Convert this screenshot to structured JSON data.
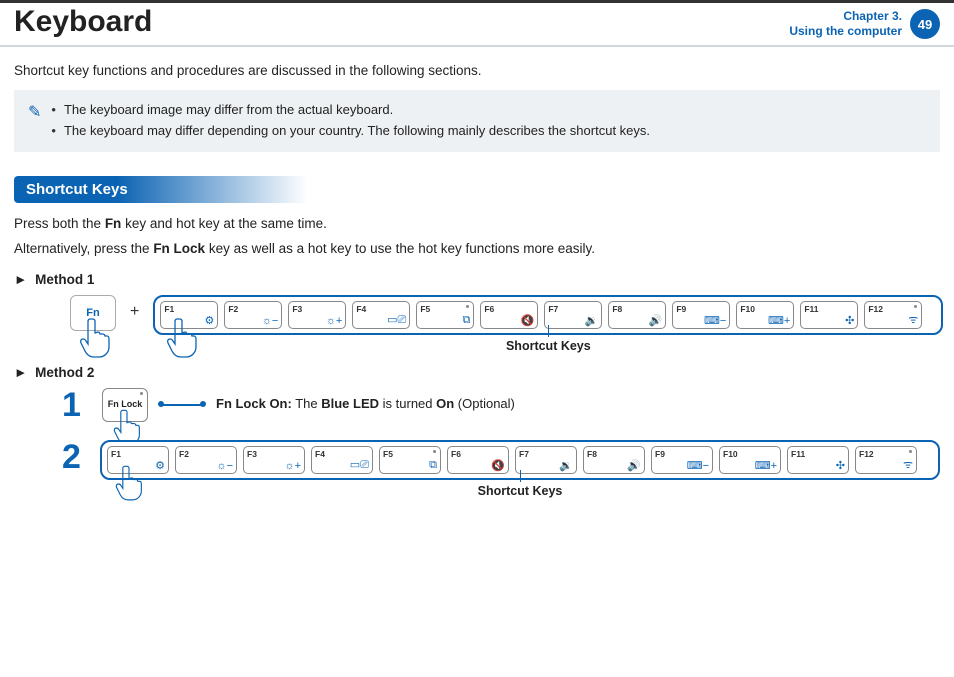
{
  "header": {
    "title": "Keyboard",
    "chapter_line1": "Chapter 3.",
    "chapter_line2": "Using the computer",
    "page_number": "49"
  },
  "intro": "Shortcut key functions and procedures are discussed in the following sections.",
  "notes": {
    "item1": "The keyboard image may differ from the actual keyboard.",
    "item2": "The keyboard may differ depending on your country. The following mainly describes the shortcut keys."
  },
  "section_heading": "Shortcut Keys",
  "body1_pre": "Press both the ",
  "body1_b": "Fn",
  "body1_post": " key and hot key at the same time.",
  "body2_pre": "Alternatively, press the ",
  "body2_b": "Fn Lock",
  "body2_post": " key as well as a hot key to use the hot key functions more easily.",
  "method1_title": "Method 1",
  "method2_title": "Method 2",
  "fn_label": "Fn",
  "plus": "+",
  "strip_caption": "Shortcut Keys",
  "step1_num": "1",
  "step2_num": "2",
  "fnlock_label": "Fn Lock",
  "callout_b1": "Fn Lock On:",
  "callout_mid": " The ",
  "callout_b2": "Blue LED",
  "callout_mid2": " is turned ",
  "callout_b3": "On",
  "callout_end": " (Optional)",
  "fkeys": {
    "f1": {
      "lbl": "F1",
      "ic": "⚙"
    },
    "f2": {
      "lbl": "F2",
      "ic": "☼−"
    },
    "f3": {
      "lbl": "F3",
      "ic": "☼+"
    },
    "f4": {
      "lbl": "F4",
      "ic": "▭⎚"
    },
    "f5": {
      "lbl": "F5",
      "ic": "⧉"
    },
    "f6": {
      "lbl": "F6",
      "ic": "🔇"
    },
    "f7": {
      "lbl": "F7",
      "ic": "🔉"
    },
    "f8": {
      "lbl": "F8",
      "ic": "🔊"
    },
    "f9": {
      "lbl": "F9",
      "ic": "⌨−"
    },
    "f10": {
      "lbl": "F10",
      "ic": "⌨+"
    },
    "f11": {
      "lbl": "F11",
      "ic": "✣"
    },
    "f12": {
      "lbl": "F12",
      "ic": "ᯤ"
    }
  }
}
